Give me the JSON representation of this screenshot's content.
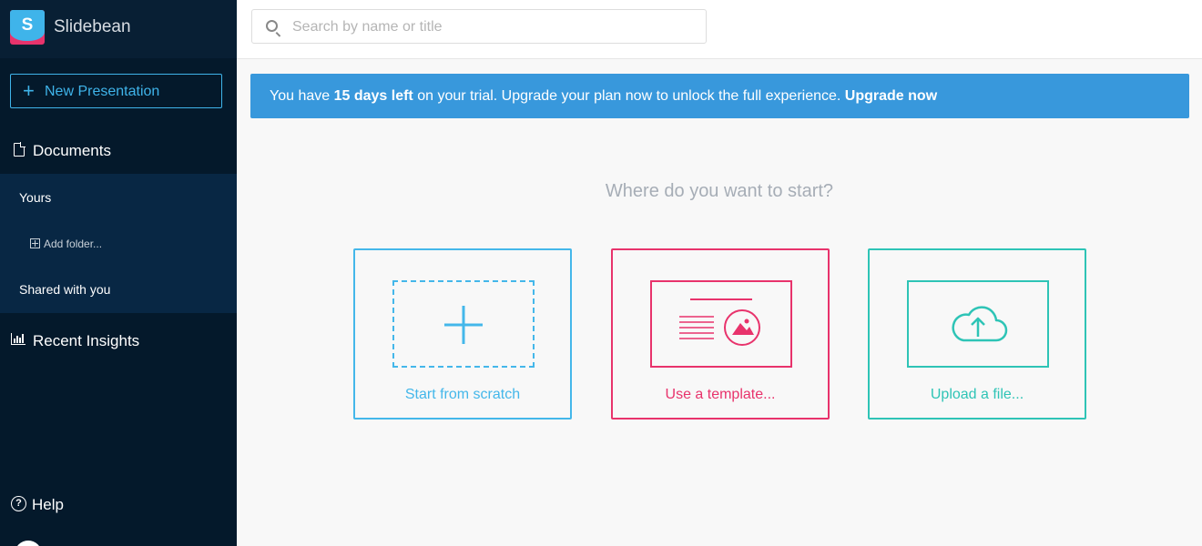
{
  "brand": {
    "name": "Slidebean",
    "logo_letter": "S"
  },
  "sidebar": {
    "new_button": "New Presentation",
    "documents": "Documents",
    "sub": {
      "yours": "Yours",
      "add_folder": "Add folder...",
      "shared": "Shared with you"
    },
    "insights": "Recent Insights",
    "help": "Help"
  },
  "search": {
    "placeholder": "Search by name or title",
    "value": ""
  },
  "banner": {
    "prefix": "You have ",
    "days": "15 days left",
    "middle": " on your trial. Upgrade your plan now to unlock the full experience. ",
    "cta": "Upgrade now"
  },
  "main": {
    "question": "Where do you want to start?",
    "cards": [
      {
        "label": "Start from scratch",
        "icon": "plus-icon",
        "color": "#44b7ea"
      },
      {
        "label": "Use a template...",
        "icon": "template-icon",
        "color": "#e8336c"
      },
      {
        "label": "Upload a file...",
        "icon": "cloud-upload-icon",
        "color": "#2ec4b6"
      }
    ]
  },
  "colors": {
    "sidebar_bg": "#04192b",
    "accent": "#3fb4ea",
    "banner": "#3898dc"
  }
}
